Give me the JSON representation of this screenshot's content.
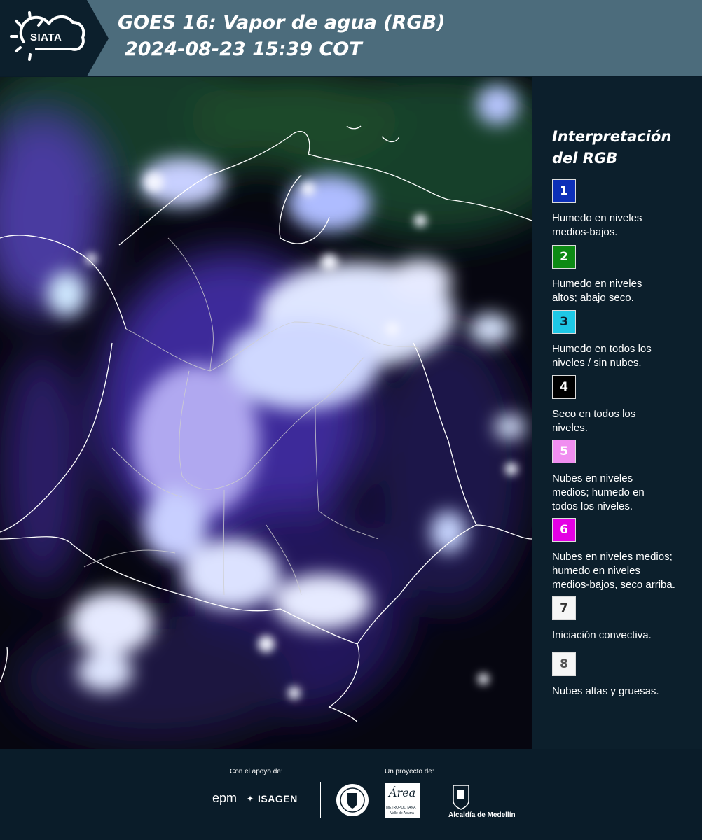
{
  "header": {
    "logo_text": "SIATA",
    "title_line1": "GOES 16: Vapor de agua (RGB)",
    "title_line2": "2024-08-23 15:39 COT"
  },
  "legend": {
    "title_line1": "Interpretación",
    "title_line2": "del RGB",
    "items": [
      {
        "num": "1",
        "color": "#0d2fb8",
        "text_color": "#ffffff",
        "lines": [
          "Humedo en niveles",
          "medios-bajos."
        ]
      },
      {
        "num": "2",
        "color": "#0d8a14",
        "text_color": "#ffffff",
        "lines": [
          "Humedo en niveles",
          "altos; abajo seco."
        ]
      },
      {
        "num": "3",
        "color": "#1ec8e6",
        "text_color": "#0c1f2c",
        "lines": [
          "Humedo en todos los",
          "niveles / sin nubes."
        ]
      },
      {
        "num": "4",
        "color": "#000000",
        "text_color": "#ffffff",
        "lines": [
          "Seco en todos los",
          "niveles."
        ]
      },
      {
        "num": "5",
        "color": "#f08ef0",
        "text_color": "#ffffff",
        "lines": [
          "Nubes en niveles",
          "medios; humedo en",
          "todos los niveles."
        ]
      },
      {
        "num": "6",
        "color": "#e400e4",
        "text_color": "#ffffff",
        "lines": [
          "Nubes en niveles medios;",
          "humedo en niveles",
          "medios-bajos, seco arriba."
        ]
      },
      {
        "num": "7",
        "color": "#f6f6f6",
        "text_color": "#333333",
        "lines": [
          "Iniciación convectiva."
        ]
      },
      {
        "num": "8",
        "color": "#f6f6f6",
        "text_color": "#555555",
        "lines": [
          "Nubes altas y gruesas."
        ]
      }
    ]
  },
  "footer": {
    "support_label": "Con el apoyo de:",
    "project_label": "Un proyecto de:",
    "epm_logo": "epm",
    "isagen_logo": "ISAGEN",
    "area_logo": "Área",
    "area_sub1": "METROPOLITANA",
    "area_sub2": "Valle de Aburrá",
    "medellin_label": "Alcaldía de Medellín"
  }
}
